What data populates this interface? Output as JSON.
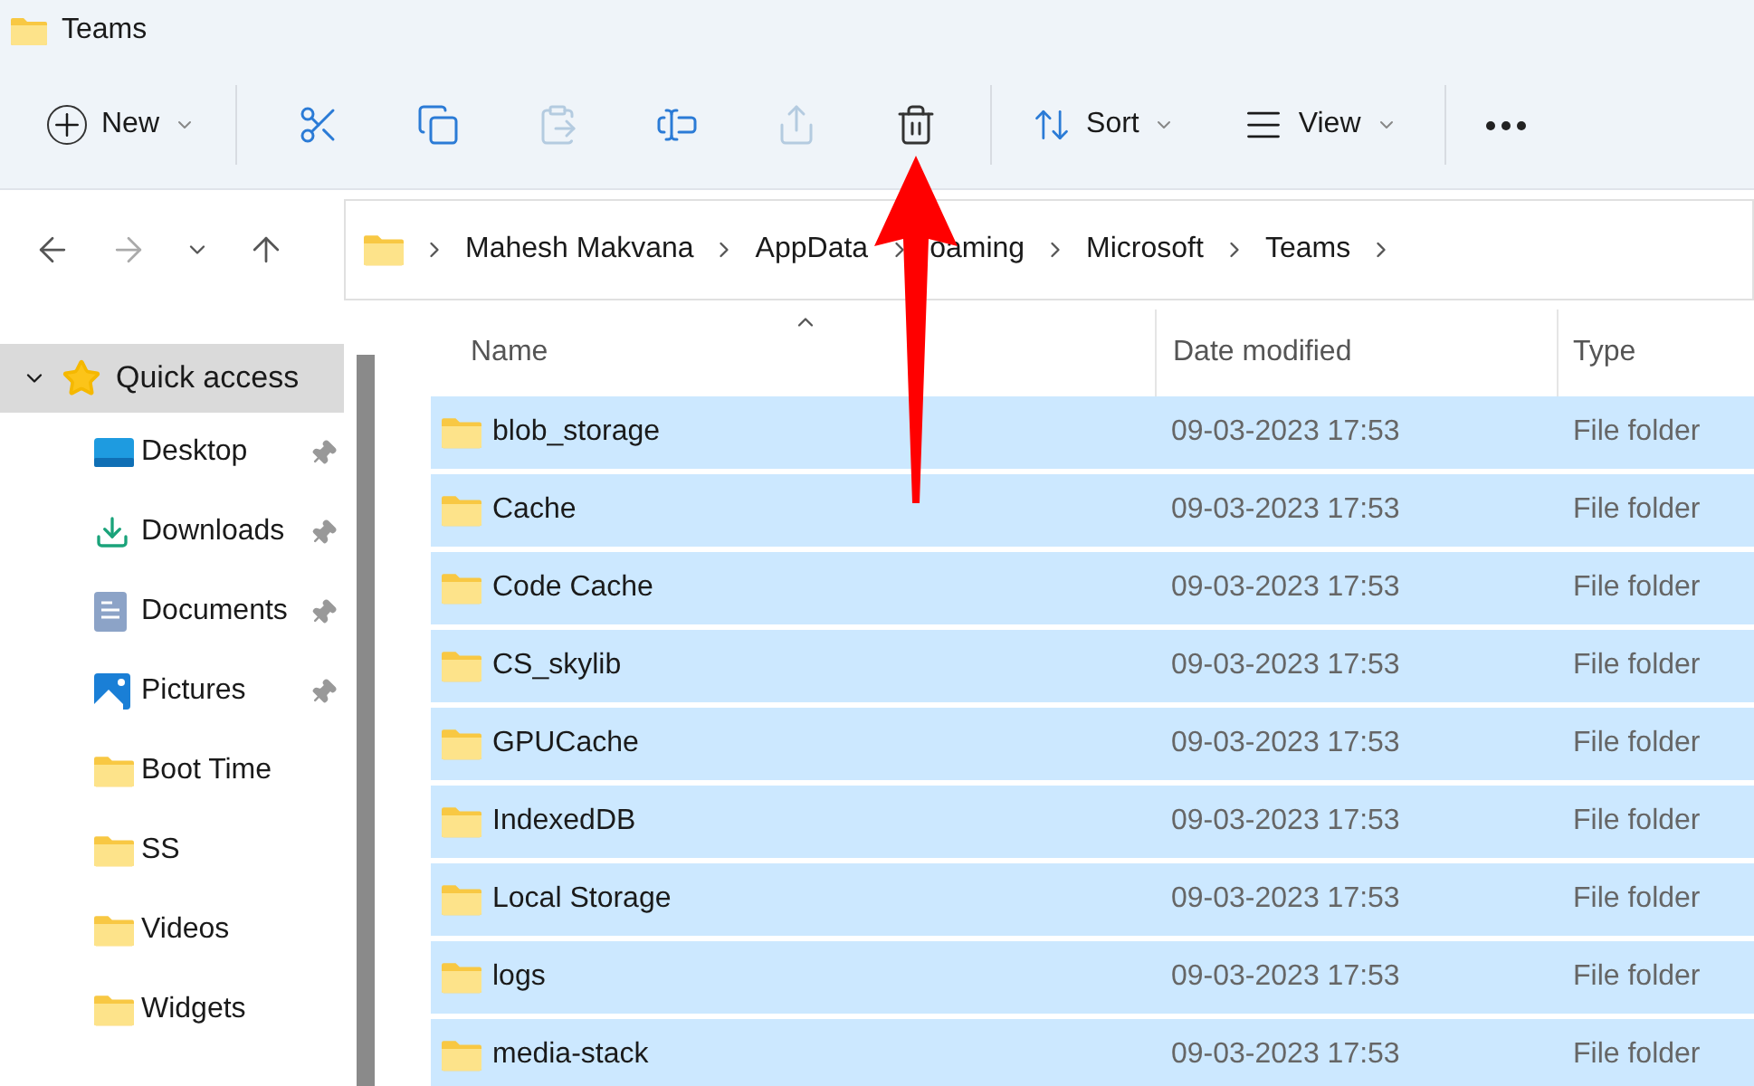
{
  "window": {
    "title": "Teams"
  },
  "toolbar": {
    "new_label": "New",
    "items": [
      {
        "kind": "cut",
        "disabled": false
      },
      {
        "kind": "copy",
        "disabled": false
      },
      {
        "kind": "paste",
        "disabled": true
      },
      {
        "kind": "rename",
        "disabled": false
      },
      {
        "kind": "share",
        "disabled": true
      },
      {
        "kind": "delete",
        "disabled": false
      }
    ],
    "sort_label": "Sort",
    "view_label": "View"
  },
  "breadcrumb": [
    "Mahesh Makvana",
    "AppData",
    "oaming",
    "Microsoft",
    "Teams"
  ],
  "sidebar": {
    "header": {
      "label": "Quick access",
      "expanded": true,
      "selected": true
    },
    "items": [
      {
        "label": "Desktop",
        "kind": "desktop",
        "pinned": true
      },
      {
        "label": "Downloads",
        "kind": "downloads",
        "pinned": true
      },
      {
        "label": "Documents",
        "kind": "documents",
        "pinned": true
      },
      {
        "label": "Pictures",
        "kind": "pictures",
        "pinned": true
      },
      {
        "label": "Boot Time",
        "kind": "folder",
        "pinned": false
      },
      {
        "label": "SS",
        "kind": "folder",
        "pinned": false
      },
      {
        "label": "Videos",
        "kind": "folder",
        "pinned": false
      },
      {
        "label": "Widgets",
        "kind": "folder",
        "pinned": false
      }
    ]
  },
  "table": {
    "columns": [
      "Name",
      "Date modified",
      "Type"
    ],
    "rows": [
      {
        "name": "blob_storage",
        "date": "09-03-2023 17:53",
        "type": "File folder",
        "selected": true
      },
      {
        "name": "Cache",
        "date": "09-03-2023 17:53",
        "type": "File folder",
        "selected": true
      },
      {
        "name": "Code Cache",
        "date": "09-03-2023 17:53",
        "type": "File folder",
        "selected": true
      },
      {
        "name": "CS_skylib",
        "date": "09-03-2023 17:53",
        "type": "File folder",
        "selected": true
      },
      {
        "name": "GPUCache",
        "date": "09-03-2023 17:53",
        "type": "File folder",
        "selected": true
      },
      {
        "name": "IndexedDB",
        "date": "09-03-2023 17:53",
        "type": "File folder",
        "selected": true
      },
      {
        "name": "Local Storage",
        "date": "09-03-2023 17:53",
        "type": "File folder",
        "selected": true
      },
      {
        "name": "logs",
        "date": "09-03-2023 17:53",
        "type": "File folder",
        "selected": true
      },
      {
        "name": "media-stack",
        "date": "09-03-2023 17:53",
        "type": "File folder",
        "selected": true
      }
    ]
  }
}
